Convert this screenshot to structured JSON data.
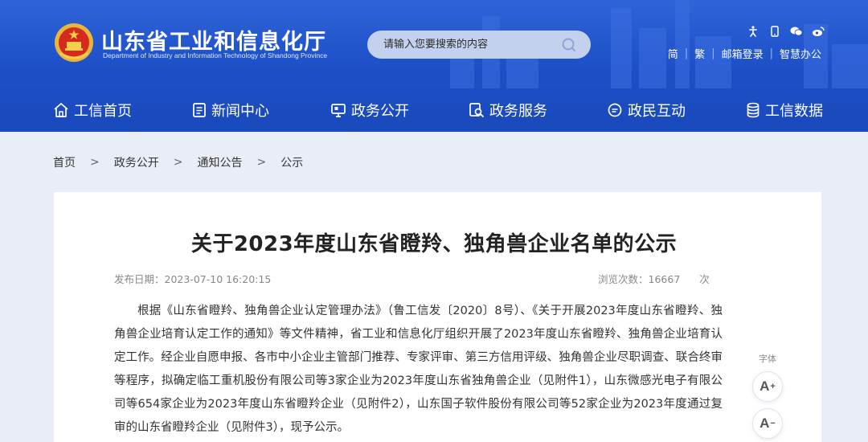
{
  "header": {
    "title": "山东省工业和信息化厅",
    "subtitle": "Department of Industry and Information Technology of Shandong Province",
    "search_placeholder": "请输入您要搜索的内容",
    "top_icons": [
      "accessibility-icon",
      "mobile-icon",
      "wechat-icon",
      "weibo-icon"
    ],
    "top_links": [
      "简",
      "繁",
      "邮箱登录",
      "智慧办公"
    ],
    "colors": {
      "primary": "#1c4fc6",
      "nav_text": "#ffffff"
    }
  },
  "nav": {
    "items": [
      {
        "label": "工信首页",
        "icon": "home-icon"
      },
      {
        "label": "新闻中心",
        "icon": "document-icon"
      },
      {
        "label": "政务公开",
        "icon": "monitor-icon"
      },
      {
        "label": "政务服务",
        "icon": "service-search-icon"
      },
      {
        "label": "政民互动",
        "icon": "chat-icon"
      },
      {
        "label": "工信数据",
        "icon": "database-icon"
      }
    ]
  },
  "breadcrumb": {
    "items": [
      "首页",
      "政务公开",
      "通知公告",
      "公示"
    ],
    "separator": ">"
  },
  "article": {
    "title": "关于2023年度山东省瞪羚、独角兽企业名单的公示",
    "publish_label": "发布日期：",
    "publish_date": "2023-07-10 16:20:15",
    "views_label": "浏览次数：",
    "views": "16667",
    "views_unit": "次",
    "body": "根据《山东省瞪羚、独角兽企业认定管理办法》（鲁工信发〔2020〕8号）、《关于开展2023年度山东省瞪羚、独角兽企业培育认定工作的通知》等文件精神，省工业和信息化厅组织开展了2023年度山东省瞪羚、独角兽企业培育认定工作。经企业自愿申报、各市中小企业主管部门推荐、专家评审、第三方信用评级、独角兽企业尽职调查、联合终审等程序，拟确定临工重机股份有限公司等3家企业为2023年度山东省独角兽企业（见附件1），山东微感光电子有限公司等654家企业为2023年度山东省瞪羚企业（见附件2），山东国子软件股份有限公司等52家企业为2023年度通过复审的山东省瞪羚企业（见附件3），现予公示。"
  },
  "font_tools": {
    "label": "字体",
    "increase": "A",
    "increase_mark": "+",
    "decrease": "A",
    "decrease_mark": "−"
  }
}
